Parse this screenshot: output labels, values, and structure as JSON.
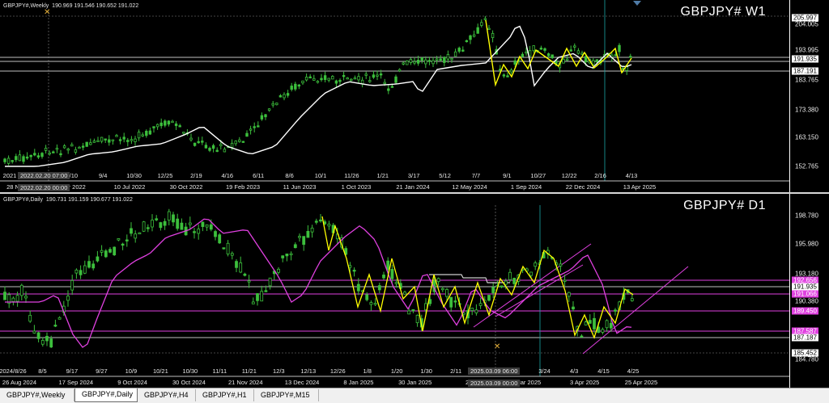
{
  "weekly": {
    "header": "GBPJPY#,Weekly  190.969 191.546 190.652 191.022",
    "title": "GBPJPY# W1",
    "y_ticks": [
      "204.005",
      "193.995",
      "183.765",
      "173.380",
      "163.150",
      "152.765"
    ],
    "price_tags": [
      {
        "label": "205.997",
        "bg": "#ffffff",
        "fg": "#000000"
      },
      {
        "label": "191.935",
        "bg": "#ffffff",
        "fg": "#000000"
      },
      {
        "label": "187.191",
        "bg": "#ffffff",
        "fg": "#000000"
      }
    ],
    "x_ticks": [
      "2021",
      "5/15",
      "7/10",
      "9/4",
      "10/30",
      "12/25",
      "2/19",
      "4/16",
      "6/11",
      "8/6",
      "10/1",
      "11/26",
      "1/21",
      "3/17",
      "5/12",
      "7/7",
      "9/1",
      "10/27",
      "12/22",
      "2/16",
      "4/13"
    ],
    "x_ticks_bottom": [
      "28 Nov",
      "Mar 2022",
      "10 Jul 2022",
      "30 Oct 2022",
      "19 Feb 2023",
      "11 Jun 2023",
      "1 Oct 2023",
      "21 Jan 2024",
      "12 May 2024",
      "1 Sep 2024",
      "22 Dec 2024",
      "13 Apr 2025"
    ],
    "crosshair_top": "2022.02.20 07:00",
    "crosshair_bottom": "2022.02.20 00:00"
  },
  "daily": {
    "header": "GBPJPY#,Daily  190.731 191.159 190.677 191.022",
    "title": "GBPJPY# D1",
    "y_ticks": [
      "198.780",
      "195.980",
      "193.180",
      "190.380",
      "184.780"
    ],
    "price_tags": [
      {
        "label": "192.656",
        "bg": "#e040e0",
        "fg": "#ffffff"
      },
      {
        "label": "191.935",
        "bg": "#ffffff",
        "fg": "#000000"
      },
      {
        "label": "191.066",
        "bg": "#e040e0",
        "fg": "#ffffff"
      },
      {
        "label": "189.450",
        "bg": "#e040e0",
        "fg": "#ffffff"
      },
      {
        "label": "187.587",
        "bg": "#e040e0",
        "fg": "#ffffff"
      },
      {
        "label": "187.187",
        "bg": "#ffffff",
        "fg": "#000000"
      },
      {
        "label": "185.452",
        "bg": "#ffffff",
        "fg": "#000000"
      }
    ],
    "x_ticks": [
      "2024/8/26",
      "8/5",
      "9/17",
      "9/27",
      "10/9",
      "10/21",
      "10/30",
      "11/11",
      "11/21",
      "12/3",
      "12/13",
      "12/26",
      "1/8",
      "1/20",
      "1/30",
      "2/11",
      "2/21",
      "3/4",
      "3/24",
      "4/3",
      "4/15",
      "4/25"
    ],
    "x_ticks_bottom": [
      "26 Aug 2024",
      "17 Sep 2024",
      "9 Oct 2024",
      "30 Oct 2024",
      "21 Nov 2024",
      "13 Dec 2024",
      "8 Jan 2025",
      "30 Jan 2025",
      "21 F",
      "Mar 2025",
      "3 Apr 2025",
      "25 Apr 2025"
    ],
    "crosshair_top": "2025.03.09 06:00",
    "crosshair_bottom": "2025.03.09 00:00"
  },
  "tabs": [
    {
      "label": "GBPJPY#,Weekly",
      "active": false
    },
    {
      "label": "GBPJPY#,Daily",
      "active": true
    },
    {
      "label": "GBPJPY#,H4",
      "active": false
    },
    {
      "label": "GBPJPY#,H1",
      "active": false
    },
    {
      "label": "GBPJPY#,M15",
      "active": false
    }
  ],
  "colors": {
    "candle": "#3cbf3c",
    "ma_weekly": "#ffffff",
    "ma_daily": "#e040e0",
    "zigzag": "#ffff00",
    "trend": "#e040e0",
    "hline_white": "#ffffff",
    "vline": "#1aa5a5"
  }
}
